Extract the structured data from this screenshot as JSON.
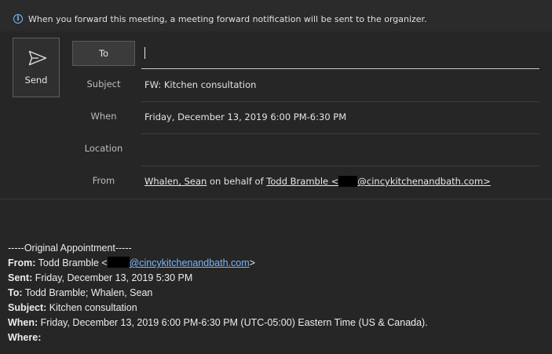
{
  "info_bar": {
    "text": "When you forward this meeting, a meeting forward notification will be sent to the organizer."
  },
  "compose": {
    "send_label": "Send",
    "to_label": "To",
    "to_value": "",
    "subject_label": "Subject",
    "subject_value": "FW: Kitchen consultation",
    "when_label": "When",
    "when_value": "Friday, December 13, 2019 6:00 PM-6:30 PM",
    "location_label": "Location",
    "location_value": "",
    "from_label": "From",
    "from_sender": "Whalen, Sean",
    "from_on_behalf": "on behalf of",
    "from_owner_open": "Todd Bramble <",
    "from_domain": "@cincykitchenandbath.com>"
  },
  "body": {
    "header_line": "-----Original Appointment-----",
    "from_label": "From:",
    "from_name": "Todd Bramble <",
    "from_email_domain": "@cincykitchenandbath.com",
    "from_close": ">",
    "sent_label": "Sent:",
    "sent_value": "Friday, December 13, 2019 5:30 PM",
    "to_label": "To:",
    "to_value": "Todd Bramble; Whalen, Sean",
    "subject_label": "Subject:",
    "subject_value": "Kitchen consultation",
    "when_label": "When:",
    "when_value": "Friday, December 13, 2019 6:00 PM-6:30 PM (UTC-05:00) Eastern Time (US & Canada).",
    "where_label": "Where:",
    "where_value": ""
  },
  "icons": {
    "info": "info-icon",
    "send": "send-icon"
  },
  "colors": {
    "background": "#262626",
    "link": "#79b8ff",
    "info_icon": "#6fb7ff"
  }
}
